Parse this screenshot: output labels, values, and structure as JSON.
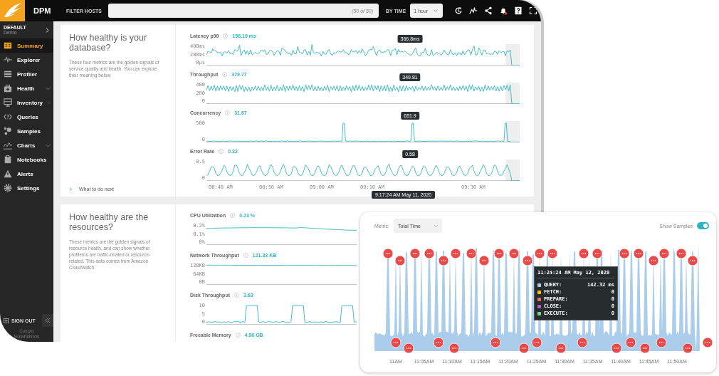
{
  "topbar": {
    "app_name": "DPM",
    "filter_label": "FILTER HOSTS",
    "filter_count": "(50 of 50)",
    "time_label": "BY TIME",
    "time_value": "1 hour",
    "unread_alerts": true
  },
  "sidebar": {
    "account": "DEFAULT",
    "environment": "Demo",
    "items": [
      {
        "label": "Summary",
        "kind": "summary",
        "selected": true,
        "expandable": false
      },
      {
        "label": "Explorer",
        "kind": "explorer",
        "selected": false,
        "expandable": false
      },
      {
        "label": "Profiler",
        "kind": "profiler",
        "selected": false,
        "expandable": false
      },
      {
        "label": "Health",
        "kind": "health",
        "selected": false,
        "expandable": true
      },
      {
        "label": "Inventory",
        "kind": "inventory",
        "selected": false,
        "expandable": true
      },
      {
        "label": "Queries",
        "kind": "queries",
        "selected": false,
        "expandable": false
      },
      {
        "label": "Samples",
        "kind": "samples",
        "selected": false,
        "expandable": false
      },
      {
        "label": "Charts",
        "kind": "charts",
        "selected": false,
        "expandable": true
      },
      {
        "label": "Notebooks",
        "kind": "notebooks",
        "selected": false,
        "expandable": false
      },
      {
        "label": "Alerts",
        "kind": "alerts",
        "selected": false,
        "expandable": false
      },
      {
        "label": "Settings",
        "kind": "settings",
        "selected": false,
        "expandable": false
      }
    ],
    "sign_out": "SIGN OUT",
    "copyright": "©2020",
    "company": "SolarWinds"
  },
  "sections": [
    {
      "title": "How healthy is your database?",
      "description": "These four metrics are the golden signals of service quality and health. You can explore their meaning below.",
      "link": "What to do next",
      "metrics": [
        {
          "name": "Latency p99",
          "value": "156.19 ms",
          "kind": "noisy",
          "y_ticks": [
            "400ms",
            "200ms",
            "0µs"
          ],
          "tooltip": "366.8ms"
        },
        {
          "name": "Throughput",
          "value": "379.77",
          "kind": "dense",
          "y_ticks": [
            "400",
            "200",
            "0"
          ],
          "tooltip": "349.81"
        },
        {
          "name": "Concurrency",
          "value": "31.67",
          "kind": "spiky",
          "y_ticks": [
            "500",
            "0"
          ],
          "tooltip": "651.9"
        },
        {
          "name": "Error Rate",
          "value": "0.32",
          "kind": "wave",
          "y_ticks": [
            "0.5",
            "0"
          ],
          "tooltip": "0.58"
        }
      ],
      "x_ticks": [
        "08:40 AM",
        "08:50 AM",
        "09:00 AM",
        "09:10 AM",
        "09:30 AM"
      ],
      "time_tooltip": "9:17:24 AM May 11, 2020"
    },
    {
      "title": "How healthy are the resources?",
      "description": "These metrics are the golden signals of resource health, and can show whether problems are traffic-related or resource-related. This data comes from Amazon CloudWatch.",
      "metrics": [
        {
          "name": "CPU Utilization",
          "value": "0.23 %",
          "kind": "plateau",
          "y_ticks": [
            "0.2%",
            "0.1%",
            "0%"
          ]
        },
        {
          "name": "Network Throughput",
          "value": "121.33 KB",
          "kind": "flat",
          "y_ticks": [
            "128KB",
            "64KB",
            "0B"
          ]
        },
        {
          "name": "Disk Throughput",
          "value": "3.63",
          "kind": "pulses",
          "y_ticks": [
            "10",
            "5",
            "0"
          ]
        },
        {
          "name": "Freeable Memory",
          "value": "4.96 GB"
        }
      ]
    }
  ],
  "samples_panel": {
    "metric_label": "Metric:",
    "metric_value": "Total Time",
    "show_samples_label": "Show Samples",
    "show_samples": true,
    "tooltip": {
      "time": "11:24:24 AM May 12, 2020",
      "rows": [
        {
          "label": "QUERY:",
          "value": "142.32 ms",
          "color": "#a9cdea"
        },
        {
          "label": "FETCH:",
          "value": "0",
          "color": "#f2c200"
        },
        {
          "label": "PREPARE:",
          "value": "0",
          "color": "#e9725a"
        },
        {
          "label": "CLOSE:",
          "value": "0",
          "color": "#b561c4"
        },
        {
          "label": "EXECUTE:",
          "value": "0",
          "color": "#80d080"
        }
      ]
    },
    "x_ticks": [
      "11AM",
      "11:05AM",
      "11:10AM",
      "11:15AM",
      "11:20AM",
      "11:25AM",
      "11:30AM",
      "11:35AM",
      "11:40AM",
      "11:45AM",
      "11:50AM"
    ]
  }
}
